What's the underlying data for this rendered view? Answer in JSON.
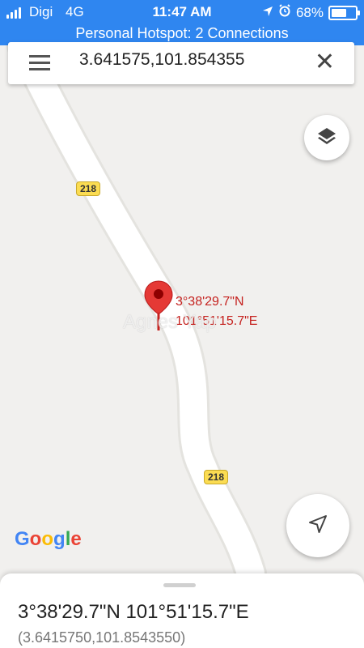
{
  "status_bar": {
    "carrier": "Digi",
    "network": "4G",
    "time": "11:47 AM",
    "battery": "68%",
    "battery_level": 0.68,
    "hotspot": "Personal Hotspot: 2 Connections"
  },
  "search": {
    "query": "3.641575,101.854355"
  },
  "map": {
    "road_shields": [
      "218",
      "218"
    ],
    "pin_label_line1": "3°38'29.7\"N",
    "pin_label_line2": "101°51'15.7\"E",
    "watermark": "Agnes Yap",
    "google_logo": [
      "G",
      "o",
      "o",
      "g",
      "l",
      "e"
    ],
    "pin_color": "#c5221f",
    "road_color": "#ffffff"
  },
  "bottom_sheet": {
    "title": "3°38'29.7\"N 101°51'15.7\"E",
    "subtitle": "(3.6415750,101.8543550)"
  }
}
